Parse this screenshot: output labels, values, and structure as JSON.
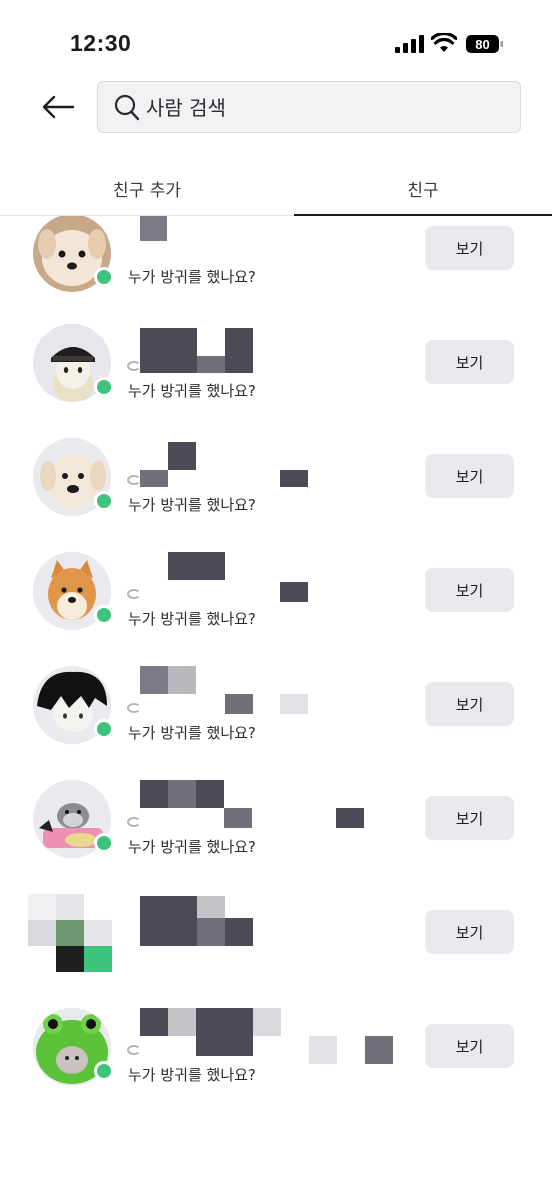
{
  "status_bar": {
    "time": "12:30",
    "battery": "80",
    "icons": [
      "signal-icon",
      "wifi-icon",
      "battery-icon"
    ]
  },
  "header": {
    "back_icon": "arrow-left-icon",
    "search_placeholder": "사람 검색",
    "search_icon": "search-icon"
  },
  "tabs": [
    {
      "label": "친구 추가",
      "active": false
    },
    {
      "label": "친구",
      "active": true
    }
  ],
  "colors": {
    "online": "#3cc47c",
    "button_bg": "#e8e8ed",
    "search_bg": "#f2f2f5",
    "active_tab_underline": "#1c1c1e",
    "censor_dark": "#4a4b55",
    "censor_light": "#d9d9dd"
  },
  "friends": [
    {
      "avatar": "white-puppy-avatar",
      "online": true,
      "status": "누가 방귀를 했나요?",
      "button": "보기"
    },
    {
      "avatar": "character-with-hat-avatar",
      "online": true,
      "status": "누가 방귀를 했나요?",
      "button": "보기"
    },
    {
      "avatar": "labrador-puppy-avatar",
      "online": true,
      "status": "누가 방귀를 했나요?",
      "button": "보기"
    },
    {
      "avatar": "shiba-dog-avatar",
      "online": true,
      "status": "누가 방귀를 했나요?",
      "button": "보기"
    },
    {
      "avatar": "black-hair-character-avatar",
      "online": true,
      "status": "누가 방귀를 했나요?",
      "button": "보기"
    },
    {
      "avatar": "seal-character-avatar",
      "online": true,
      "status": "누가 방귀를 했나요?",
      "button": "보기"
    },
    {
      "avatar": "censored-avatar",
      "online": true,
      "status": "",
      "button": "보기"
    },
    {
      "avatar": "frog-costume-avatar",
      "online": true,
      "status": "누가 방귀를 했나요?",
      "button": "보기"
    }
  ]
}
